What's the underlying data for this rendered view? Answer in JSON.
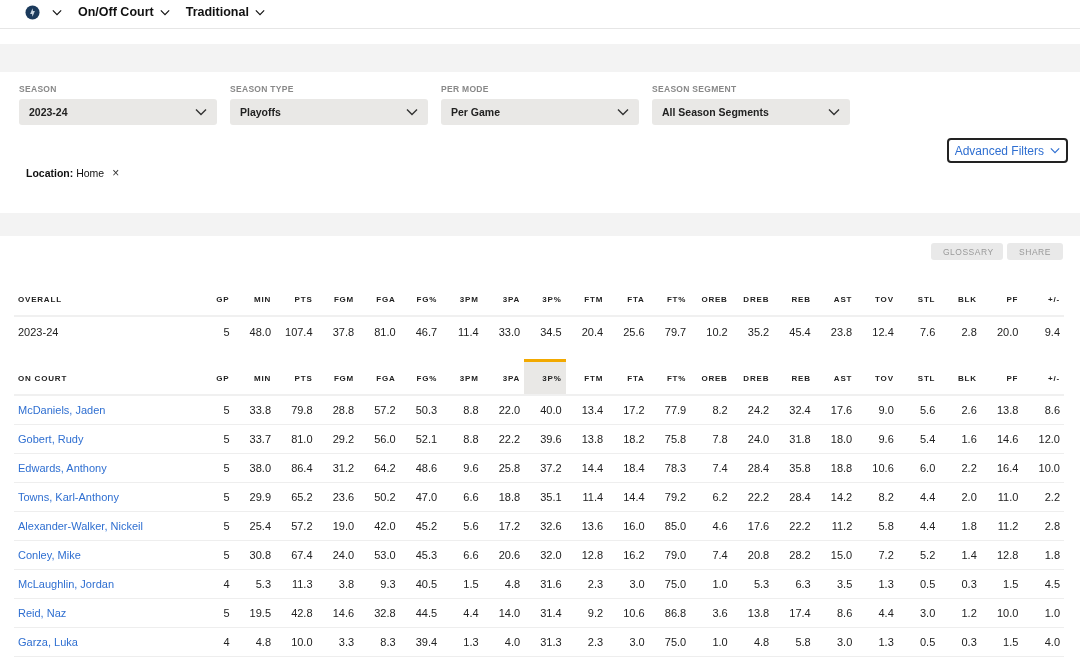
{
  "top_bar": {
    "dropdowns": [
      "On/Off Court",
      "Traditional"
    ]
  },
  "filters": [
    {
      "label": "SEASON",
      "value": "2023-24"
    },
    {
      "label": "SEASON TYPE",
      "value": "Playoffs"
    },
    {
      "label": "PER MODE",
      "value": "Per Game"
    },
    {
      "label": "SEASON SEGMENT",
      "value": "All Season Segments"
    }
  ],
  "advanced_filters": "Advanced Filters",
  "active_filter": {
    "label": "Location:",
    "value": "Home",
    "remove": "×"
  },
  "actions": [
    "GLOSSARY",
    "SHARE"
  ],
  "overall": {
    "columns": [
      {
        "label": "OVERALL",
        "sorted": false
      },
      {
        "label": "GP",
        "sorted": false
      },
      {
        "label": "MIN",
        "sorted": false
      },
      {
        "label": "PTS",
        "sorted": false
      },
      {
        "label": "FGM",
        "sorted": false
      },
      {
        "label": "FGA",
        "sorted": false
      },
      {
        "label": "FG%",
        "sorted": false
      },
      {
        "label": "3PM",
        "sorted": false
      },
      {
        "label": "3PA",
        "sorted": false
      },
      {
        "label": "3P%",
        "sorted": false
      },
      {
        "label": "FTM",
        "sorted": false
      },
      {
        "label": "FTA",
        "sorted": false
      },
      {
        "label": "FT%",
        "sorted": false
      },
      {
        "label": "OREB",
        "sorted": false
      },
      {
        "label": "DREB",
        "sorted": false
      },
      {
        "label": "REB",
        "sorted": false
      },
      {
        "label": "AST",
        "sorted": false
      },
      {
        "label": "TOV",
        "sorted": false
      },
      {
        "label": "STL",
        "sorted": false
      },
      {
        "label": "BLK",
        "sorted": false
      },
      {
        "label": "PF",
        "sorted": false
      },
      {
        "label": "+/-",
        "sorted": false
      }
    ],
    "rows": [
      [
        "2023-24",
        "5",
        "48.0",
        "107.4",
        "37.8",
        "81.0",
        "46.7",
        "11.4",
        "33.0",
        "34.5",
        "20.4",
        "25.6",
        "79.7",
        "10.2",
        "35.2",
        "45.4",
        "23.8",
        "12.4",
        "7.6",
        "2.8",
        "20.0",
        "9.4"
      ]
    ]
  },
  "on_court": {
    "columns": [
      {
        "label": "ON COURT",
        "sorted": false
      },
      {
        "label": "GP",
        "sorted": false
      },
      {
        "label": "MIN",
        "sorted": false
      },
      {
        "label": "PTS",
        "sorted": false
      },
      {
        "label": "FGM",
        "sorted": false
      },
      {
        "label": "FGA",
        "sorted": false
      },
      {
        "label": "FG%",
        "sorted": false
      },
      {
        "label": "3PM",
        "sorted": false
      },
      {
        "label": "3PA",
        "sorted": false
      },
      {
        "label": "3P%",
        "sorted": true
      },
      {
        "label": "FTM",
        "sorted": false
      },
      {
        "label": "FTA",
        "sorted": false
      },
      {
        "label": "FT%",
        "sorted": false
      },
      {
        "label": "OREB",
        "sorted": false
      },
      {
        "label": "DREB",
        "sorted": false
      },
      {
        "label": "REB",
        "sorted": false
      },
      {
        "label": "AST",
        "sorted": false
      },
      {
        "label": "TOV",
        "sorted": false
      },
      {
        "label": "STL",
        "sorted": false
      },
      {
        "label": "BLK",
        "sorted": false
      },
      {
        "label": "PF",
        "sorted": false
      },
      {
        "label": "+/-",
        "sorted": false
      }
    ],
    "rows": [
      [
        "McDaniels, Jaden",
        "5",
        "33.8",
        "79.8",
        "28.8",
        "57.2",
        "50.3",
        "8.8",
        "22.0",
        "40.0",
        "13.4",
        "17.2",
        "77.9",
        "8.2",
        "24.2",
        "32.4",
        "17.6",
        "9.0",
        "5.6",
        "2.6",
        "13.8",
        "8.6"
      ],
      [
        "Gobert, Rudy",
        "5",
        "33.7",
        "81.0",
        "29.2",
        "56.0",
        "52.1",
        "8.8",
        "22.2",
        "39.6",
        "13.8",
        "18.2",
        "75.8",
        "7.8",
        "24.0",
        "31.8",
        "18.0",
        "9.6",
        "5.4",
        "1.6",
        "14.6",
        "12.0"
      ],
      [
        "Edwards, Anthony",
        "5",
        "38.0",
        "86.4",
        "31.2",
        "64.2",
        "48.6",
        "9.6",
        "25.8",
        "37.2",
        "14.4",
        "18.4",
        "78.3",
        "7.4",
        "28.4",
        "35.8",
        "18.8",
        "10.6",
        "6.0",
        "2.2",
        "16.4",
        "10.0"
      ],
      [
        "Towns, Karl-Anthony",
        "5",
        "29.9",
        "65.2",
        "23.6",
        "50.2",
        "47.0",
        "6.6",
        "18.8",
        "35.1",
        "11.4",
        "14.4",
        "79.2",
        "6.2",
        "22.2",
        "28.4",
        "14.2",
        "8.2",
        "4.4",
        "2.0",
        "11.0",
        "2.2"
      ],
      [
        "Alexander-Walker, Nickeil",
        "5",
        "25.4",
        "57.2",
        "19.0",
        "42.0",
        "45.2",
        "5.6",
        "17.2",
        "32.6",
        "13.6",
        "16.0",
        "85.0",
        "4.6",
        "17.6",
        "22.2",
        "11.2",
        "5.8",
        "4.4",
        "1.8",
        "11.2",
        "2.8"
      ],
      [
        "Conley, Mike",
        "5",
        "30.8",
        "67.4",
        "24.0",
        "53.0",
        "45.3",
        "6.6",
        "20.6",
        "32.0",
        "12.8",
        "16.2",
        "79.0",
        "7.4",
        "20.8",
        "28.2",
        "15.0",
        "7.2",
        "5.2",
        "1.4",
        "12.8",
        "1.8"
      ],
      [
        "McLaughlin, Jordan",
        "4",
        "5.3",
        "11.3",
        "3.8",
        "9.3",
        "40.5",
        "1.5",
        "4.8",
        "31.6",
        "2.3",
        "3.0",
        "75.0",
        "1.0",
        "5.3",
        "6.3",
        "3.5",
        "1.3",
        "0.5",
        "0.3",
        "1.5",
        "4.5"
      ],
      [
        "Reid, Naz",
        "5",
        "19.5",
        "42.8",
        "14.6",
        "32.8",
        "44.5",
        "4.4",
        "14.0",
        "31.4",
        "9.2",
        "10.6",
        "86.8",
        "3.6",
        "13.8",
        "17.4",
        "8.6",
        "4.4",
        "3.0",
        "1.2",
        "10.0",
        "1.0"
      ],
      [
        "Garza, Luka",
        "4",
        "4.8",
        "10.0",
        "3.3",
        "8.3",
        "39.4",
        "1.3",
        "4.0",
        "31.3",
        "2.3",
        "3.0",
        "75.0",
        "1.0",
        "4.8",
        "5.8",
        "3.0",
        "1.3",
        "0.5",
        "0.3",
        "1.5",
        "4.0"
      ]
    ]
  }
}
